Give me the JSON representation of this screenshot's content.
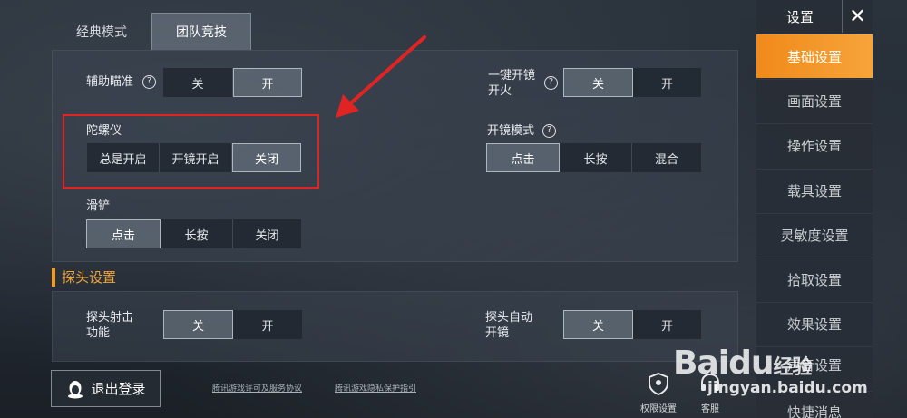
{
  "tabs": [
    "经典模式",
    "团队竞技"
  ],
  "panel1": {
    "aim_assist": {
      "label": "辅助瞄准",
      "options": [
        "关",
        "开"
      ],
      "selected": 1
    },
    "one_tap_fire": {
      "label_line1": "一键开镜",
      "label_line2": "开火",
      "options": [
        "关",
        "开"
      ],
      "selected": 0
    },
    "gyroscope": {
      "label": "陀螺仪",
      "options": [
        "总是开启",
        "开镜开启",
        "关闭"
      ],
      "selected": 2
    },
    "scope_mode": {
      "label": "开镜模式",
      "options": [
        "点击",
        "长按",
        "混合"
      ],
      "selected": 0
    },
    "slide": {
      "label": "滑铲",
      "options": [
        "点击",
        "长按",
        "关闭"
      ],
      "selected": 0
    }
  },
  "section2_title": "探头设置",
  "panel2": {
    "peek_fire": {
      "label_line1": "探头射击",
      "label_line2": "功能",
      "options": [
        "关",
        "开"
      ],
      "selected": 0
    },
    "peek_auto_scope": {
      "label_line1": "探头自动",
      "label_line2": "开镜",
      "options": [
        "关",
        "开"
      ],
      "selected": 0
    }
  },
  "sidebar": {
    "title": "设置",
    "close": "✕",
    "items": [
      "基础设置",
      "画面设置",
      "操作设置",
      "载具设置",
      "灵敏度设置",
      "拾取设置",
      "效果设置",
      "声音设置",
      "快捷消息"
    ]
  },
  "bottom": {
    "logout": "退出登录",
    "link1": "腾讯游戏许可及服务协议",
    "link2": "腾讯游戏隐私保护指引",
    "permission": "权限设置",
    "service": "客服"
  },
  "watermark": {
    "brand": "Baidu",
    "suffix": "经验",
    "url": "jingyan.baidu.com"
  },
  "colors": {
    "accent": "#f59b1f",
    "highlight": "#e02424"
  }
}
